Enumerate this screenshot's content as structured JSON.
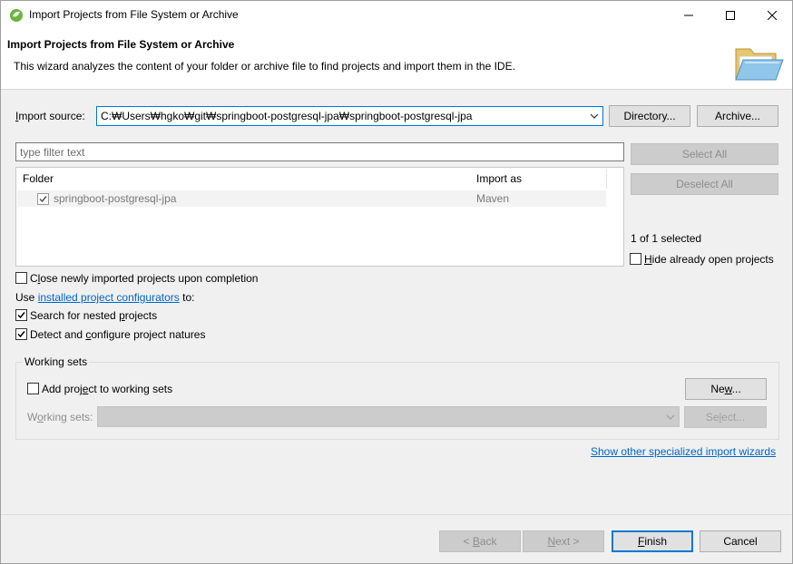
{
  "window": {
    "title": "Import Projects from File System or Archive",
    "buttons": {
      "minimize": "minimize-icon",
      "maximize": "maximize-icon",
      "close": "close-icon"
    }
  },
  "banner": {
    "title": "Import Projects from File System or Archive",
    "description": "This wizard analyzes the content of your folder or archive file to find projects and import them in the IDE.",
    "icon": "folder-icon"
  },
  "import_source": {
    "label": "Import source:",
    "value": "C:₩Users₩hgko₩git₩springboot-postgresql-jpa₩springboot-postgresql-jpa",
    "directory_button": "Directory...",
    "archive_button": "Archive..."
  },
  "filter": {
    "placeholder": "type filter text"
  },
  "selection_buttons": {
    "select_all": "Select All",
    "deselect_all": "Deselect All"
  },
  "projects_table": {
    "columns": [
      "Folder",
      "Import as"
    ],
    "rows": [
      {
        "folder": "springboot-postgresql-jpa",
        "import_as": "Maven",
        "checked": true
      }
    ]
  },
  "selection_status": "1 of 1 selected",
  "hide_open": {
    "label": "Hide already open projects",
    "checked": false
  },
  "close_imported": {
    "label": "Close newly imported projects upon completion",
    "checked": false
  },
  "configurators": {
    "prefix": "Use ",
    "link": "installed project configurators",
    "suffix": " to:"
  },
  "search_nested": {
    "label": "Search for nested projects",
    "checked": true
  },
  "detect_natures": {
    "label": "Detect and configure project natures",
    "checked": true
  },
  "working_sets": {
    "title": "Working sets",
    "add_label": "Add project to working sets",
    "add_checked": false,
    "new_button": "New...",
    "sets_label": "Working sets:",
    "select_button": "Select..."
  },
  "specialized_link": "Show other specialized import wizards",
  "footer": {
    "back": "< Back",
    "next": "Next >",
    "finish": "Finish",
    "cancel": "Cancel"
  },
  "colors": {
    "accent": "#0078d7",
    "link": "#0066cc",
    "disabled_text": "#8d8d8d"
  }
}
